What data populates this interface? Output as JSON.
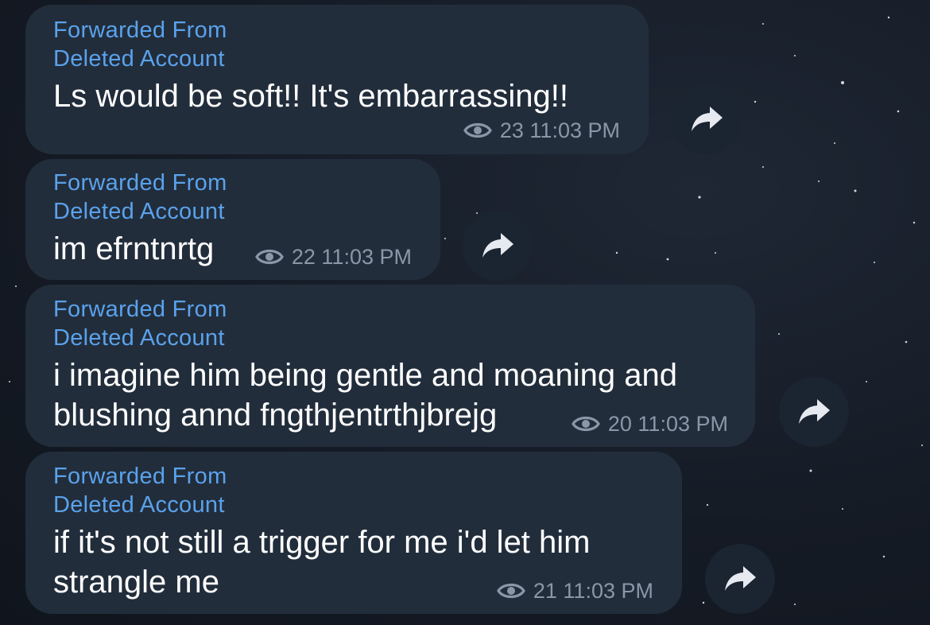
{
  "messages": [
    {
      "forwarded_label": "Forwarded From",
      "sender": "Deleted Account",
      "text_lines": [
        "Ls would be soft!! It's embarrassing!!"
      ],
      "views": "23",
      "time": "11:03 PM"
    },
    {
      "forwarded_label": "Forwarded From",
      "sender": "Deleted Account",
      "text_lines": [
        "im efrntnrtg"
      ],
      "views": "22",
      "time": "11:03 PM"
    },
    {
      "forwarded_label": "Forwarded From",
      "sender": "Deleted Account",
      "text_lines": [
        "i imagine him being gentle and moaning and",
        "blushing annd fngthjentrthjbrejg"
      ],
      "views": "20",
      "time": "11:03 PM"
    },
    {
      "forwarded_label": "Forwarded From",
      "sender": "Deleted Account",
      "text_lines": [
        "if it's not still a trigger for me i'd let him",
        "strangle me"
      ],
      "views": "21",
      "time": "11:03 PM"
    }
  ],
  "icons": {
    "views": "eye-icon",
    "share": "share-arrow-icon"
  },
  "colors": {
    "bubble": "#222d3b",
    "link": "#5aa2ec",
    "text": "#ffffff",
    "meta": "#8b97a6",
    "background": "#151b25"
  }
}
